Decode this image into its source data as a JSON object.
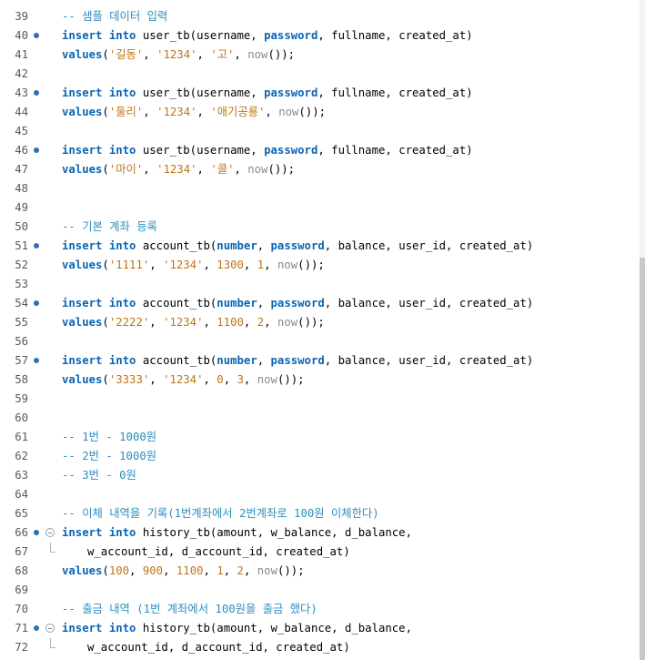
{
  "editor": {
    "lines": [
      {
        "n": "39",
        "bp": false,
        "fold": "",
        "tokens": [
          {
            "t": "-- 샘플 데이터 입력",
            "c": "cm"
          }
        ]
      },
      {
        "n": "40",
        "bp": true,
        "fold": "",
        "tokens": [
          {
            "t": "insert",
            "c": "kw"
          },
          {
            "t": " ",
            "c": "p"
          },
          {
            "t": "into",
            "c": "kw"
          },
          {
            "t": " user_tb(username, ",
            "c": "id"
          },
          {
            "t": "password",
            "c": "kw"
          },
          {
            "t": ", fullname, created_at)",
            "c": "id"
          }
        ]
      },
      {
        "n": "41",
        "bp": false,
        "fold": "",
        "tokens": [
          {
            "t": "values",
            "c": "kw"
          },
          {
            "t": "(",
            "c": "p"
          },
          {
            "t": "'길동'",
            "c": "str"
          },
          {
            "t": ", ",
            "c": "p"
          },
          {
            "t": "'1234'",
            "c": "str"
          },
          {
            "t": ", ",
            "c": "p"
          },
          {
            "t": "'고'",
            "c": "str"
          },
          {
            "t": ", ",
            "c": "p"
          },
          {
            "t": "now",
            "c": "fn"
          },
          {
            "t": "());",
            "c": "p"
          }
        ]
      },
      {
        "n": "42",
        "bp": false,
        "fold": "",
        "tokens": []
      },
      {
        "n": "43",
        "bp": true,
        "fold": "",
        "tokens": [
          {
            "t": "insert",
            "c": "kw"
          },
          {
            "t": " ",
            "c": "p"
          },
          {
            "t": "into",
            "c": "kw"
          },
          {
            "t": " user_tb(username, ",
            "c": "id"
          },
          {
            "t": "password",
            "c": "kw"
          },
          {
            "t": ", fullname, created_at)",
            "c": "id"
          }
        ]
      },
      {
        "n": "44",
        "bp": false,
        "fold": "",
        "tokens": [
          {
            "t": "values",
            "c": "kw"
          },
          {
            "t": "(",
            "c": "p"
          },
          {
            "t": "'둘리'",
            "c": "str"
          },
          {
            "t": ", ",
            "c": "p"
          },
          {
            "t": "'1234'",
            "c": "str"
          },
          {
            "t": ", ",
            "c": "p"
          },
          {
            "t": "'애기공룡'",
            "c": "str"
          },
          {
            "t": ", ",
            "c": "p"
          },
          {
            "t": "now",
            "c": "fn"
          },
          {
            "t": "());",
            "c": "p"
          }
        ]
      },
      {
        "n": "45",
        "bp": false,
        "fold": "",
        "tokens": []
      },
      {
        "n": "46",
        "bp": true,
        "fold": "",
        "tokens": [
          {
            "t": "insert",
            "c": "kw"
          },
          {
            "t": " ",
            "c": "p"
          },
          {
            "t": "into",
            "c": "kw"
          },
          {
            "t": " user_tb(username, ",
            "c": "id"
          },
          {
            "t": "password",
            "c": "kw"
          },
          {
            "t": ", fullname, created_at)",
            "c": "id"
          }
        ]
      },
      {
        "n": "47",
        "bp": false,
        "fold": "",
        "tokens": [
          {
            "t": "values",
            "c": "kw"
          },
          {
            "t": "(",
            "c": "p"
          },
          {
            "t": "'마이'",
            "c": "str"
          },
          {
            "t": ", ",
            "c": "p"
          },
          {
            "t": "'1234'",
            "c": "str"
          },
          {
            "t": ", ",
            "c": "p"
          },
          {
            "t": "'콜'",
            "c": "str"
          },
          {
            "t": ", ",
            "c": "p"
          },
          {
            "t": "now",
            "c": "fn"
          },
          {
            "t": "());",
            "c": "p"
          }
        ]
      },
      {
        "n": "48",
        "bp": false,
        "fold": "",
        "tokens": []
      },
      {
        "n": "49",
        "bp": false,
        "fold": "",
        "tokens": []
      },
      {
        "n": "50",
        "bp": false,
        "fold": "",
        "tokens": [
          {
            "t": "-- 기본 계좌 등록",
            "c": "cm"
          }
        ]
      },
      {
        "n": "51",
        "bp": true,
        "fold": "",
        "tokens": [
          {
            "t": "insert",
            "c": "kw"
          },
          {
            "t": " ",
            "c": "p"
          },
          {
            "t": "into",
            "c": "kw"
          },
          {
            "t": " account_tb(",
            "c": "id"
          },
          {
            "t": "number",
            "c": "kw"
          },
          {
            "t": ", ",
            "c": "p"
          },
          {
            "t": "password",
            "c": "kw"
          },
          {
            "t": ", balance, user_id, created_at)",
            "c": "id"
          }
        ]
      },
      {
        "n": "52",
        "bp": false,
        "fold": "",
        "tokens": [
          {
            "t": "values",
            "c": "kw"
          },
          {
            "t": "(",
            "c": "p"
          },
          {
            "t": "'1111'",
            "c": "str"
          },
          {
            "t": ", ",
            "c": "p"
          },
          {
            "t": "'1234'",
            "c": "str"
          },
          {
            "t": ", ",
            "c": "p"
          },
          {
            "t": "1300",
            "c": "num"
          },
          {
            "t": ", ",
            "c": "p"
          },
          {
            "t": "1",
            "c": "num"
          },
          {
            "t": ", ",
            "c": "p"
          },
          {
            "t": "now",
            "c": "fn"
          },
          {
            "t": "());",
            "c": "p"
          }
        ]
      },
      {
        "n": "53",
        "bp": false,
        "fold": "",
        "tokens": []
      },
      {
        "n": "54",
        "bp": true,
        "fold": "",
        "tokens": [
          {
            "t": "insert",
            "c": "kw"
          },
          {
            "t": " ",
            "c": "p"
          },
          {
            "t": "into",
            "c": "kw"
          },
          {
            "t": " account_tb(",
            "c": "id"
          },
          {
            "t": "number",
            "c": "kw"
          },
          {
            "t": ", ",
            "c": "p"
          },
          {
            "t": "password",
            "c": "kw"
          },
          {
            "t": ", balance, user_id, created_at)",
            "c": "id"
          }
        ]
      },
      {
        "n": "55",
        "bp": false,
        "fold": "",
        "tokens": [
          {
            "t": "values",
            "c": "kw"
          },
          {
            "t": "(",
            "c": "p"
          },
          {
            "t": "'2222'",
            "c": "str"
          },
          {
            "t": ", ",
            "c": "p"
          },
          {
            "t": "'1234'",
            "c": "str"
          },
          {
            "t": ", ",
            "c": "p"
          },
          {
            "t": "1100",
            "c": "num"
          },
          {
            "t": ", ",
            "c": "p"
          },
          {
            "t": "2",
            "c": "num"
          },
          {
            "t": ", ",
            "c": "p"
          },
          {
            "t": "now",
            "c": "fn"
          },
          {
            "t": "());",
            "c": "p"
          }
        ]
      },
      {
        "n": "56",
        "bp": false,
        "fold": "",
        "tokens": []
      },
      {
        "n": "57",
        "bp": true,
        "fold": "",
        "tokens": [
          {
            "t": "insert",
            "c": "kw"
          },
          {
            "t": " ",
            "c": "p"
          },
          {
            "t": "into",
            "c": "kw"
          },
          {
            "t": " account_tb(",
            "c": "id"
          },
          {
            "t": "number",
            "c": "kw"
          },
          {
            "t": ", ",
            "c": "p"
          },
          {
            "t": "password",
            "c": "kw"
          },
          {
            "t": ", balance, user_id, created_at)",
            "c": "id"
          }
        ]
      },
      {
        "n": "58",
        "bp": false,
        "fold": "",
        "tokens": [
          {
            "t": "values",
            "c": "kw"
          },
          {
            "t": "(",
            "c": "p"
          },
          {
            "t": "'3333'",
            "c": "str"
          },
          {
            "t": ", ",
            "c": "p"
          },
          {
            "t": "'1234'",
            "c": "str"
          },
          {
            "t": ", ",
            "c": "p"
          },
          {
            "t": "0",
            "c": "num"
          },
          {
            "t": ", ",
            "c": "p"
          },
          {
            "t": "3",
            "c": "num"
          },
          {
            "t": ", ",
            "c": "p"
          },
          {
            "t": "now",
            "c": "fn"
          },
          {
            "t": "());",
            "c": "p"
          }
        ]
      },
      {
        "n": "59",
        "bp": false,
        "fold": "",
        "tokens": []
      },
      {
        "n": "60",
        "bp": false,
        "fold": "",
        "tokens": []
      },
      {
        "n": "61",
        "bp": false,
        "fold": "",
        "tokens": [
          {
            "t": "-- 1번 - 1000원",
            "c": "cm"
          }
        ]
      },
      {
        "n": "62",
        "bp": false,
        "fold": "",
        "tokens": [
          {
            "t": "-- 2번 - 1000원",
            "c": "cm"
          }
        ]
      },
      {
        "n": "63",
        "bp": false,
        "fold": "",
        "tokens": [
          {
            "t": "-- 3번 - 0원",
            "c": "cm"
          }
        ]
      },
      {
        "n": "64",
        "bp": false,
        "fold": "",
        "tokens": []
      },
      {
        "n": "65",
        "bp": false,
        "fold": "",
        "tokens": [
          {
            "t": "-- 이체 내역을 기록(1번계좌에서 2번계좌로 100원 이체한다)",
            "c": "cm"
          }
        ]
      },
      {
        "n": "66",
        "bp": true,
        "fold": "start",
        "tokens": [
          {
            "t": "insert",
            "c": "kw"
          },
          {
            "t": " ",
            "c": "p"
          },
          {
            "t": "into",
            "c": "kw"
          },
          {
            "t": " history_tb(amount, w_balance, d_balance,",
            "c": "id"
          }
        ]
      },
      {
        "n": "67",
        "bp": false,
        "fold": "end",
        "cont": true,
        "tokens": [
          {
            "t": "w_account_id, d_account_id, created_at)",
            "c": "id"
          }
        ]
      },
      {
        "n": "68",
        "bp": false,
        "fold": "",
        "tokens": [
          {
            "t": "values",
            "c": "kw"
          },
          {
            "t": "(",
            "c": "p"
          },
          {
            "t": "100",
            "c": "num"
          },
          {
            "t": ", ",
            "c": "p"
          },
          {
            "t": "900",
            "c": "num"
          },
          {
            "t": ", ",
            "c": "p"
          },
          {
            "t": "1100",
            "c": "num"
          },
          {
            "t": ", ",
            "c": "p"
          },
          {
            "t": "1",
            "c": "num"
          },
          {
            "t": ", ",
            "c": "p"
          },
          {
            "t": "2",
            "c": "num"
          },
          {
            "t": ", ",
            "c": "p"
          },
          {
            "t": "now",
            "c": "fn"
          },
          {
            "t": "());",
            "c": "p"
          }
        ]
      },
      {
        "n": "69",
        "bp": false,
        "fold": "",
        "tokens": []
      },
      {
        "n": "70",
        "bp": false,
        "fold": "",
        "tokens": [
          {
            "t": "-- 출금 내역 (1번 계좌에서 100원을 출금 했다)",
            "c": "cm"
          }
        ]
      },
      {
        "n": "71",
        "bp": true,
        "fold": "start",
        "tokens": [
          {
            "t": "insert",
            "c": "kw"
          },
          {
            "t": " ",
            "c": "p"
          },
          {
            "t": "into",
            "c": "kw"
          },
          {
            "t": " history_tb(amount, w_balance, d_balance,",
            "c": "id"
          }
        ]
      },
      {
        "n": "72",
        "bp": false,
        "fold": "end",
        "cont": true,
        "tokens": [
          {
            "t": "w_account_id, d_account_id, created_at)",
            "c": "id"
          }
        ]
      }
    ]
  },
  "colors": {
    "keyword": "#0c65b3",
    "string": "#c07518",
    "comment": "#2e8ebc",
    "function": "#8a8a8a",
    "breakpoint": "#2f6fb3"
  }
}
